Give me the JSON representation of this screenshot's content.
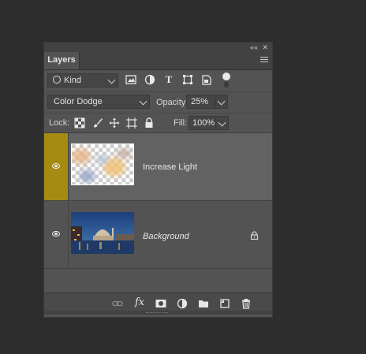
{
  "panel": {
    "tab_label": "Layers",
    "collapse_glyph": "««",
    "close_glyph": "✕"
  },
  "filter": {
    "kind_label": "Kind",
    "icons": [
      "image-filter-icon",
      "adjustment-filter-icon",
      "type-filter-icon",
      "shape-filter-icon",
      "smart-object-filter-icon"
    ],
    "type_glyph": "T"
  },
  "blend": {
    "mode": "Color Dodge",
    "opacity_label": "Opacity:",
    "opacity_value": "25%"
  },
  "lock": {
    "label": "Lock:",
    "fill_label": "Fill:",
    "fill_value": "100%"
  },
  "layers": [
    {
      "name": "Increase Light",
      "visible": true,
      "selected": true
    },
    {
      "name": "Background",
      "visible": true,
      "locked": true
    }
  ],
  "footer": {
    "fx_label": "fx",
    "icons": [
      "link-layers-icon",
      "fx-icon",
      "add-mask-icon",
      "adjustment-layer-icon",
      "group-folder-icon",
      "new-layer-icon",
      "delete-icon"
    ]
  },
  "colors": {
    "selected_accent": "#a68b12",
    "panel_bg": "#535353",
    "background": "#2d2d2d"
  }
}
